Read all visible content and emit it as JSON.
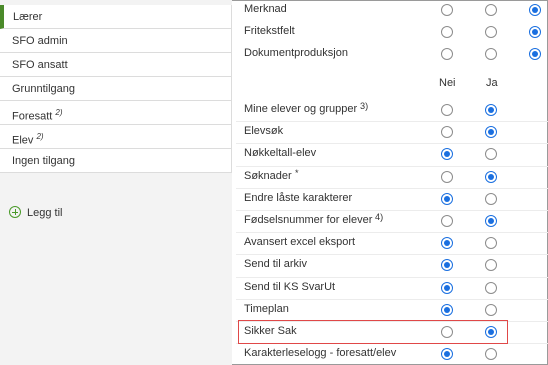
{
  "sidebar": {
    "items": [
      {
        "label": "Lærer",
        "sup": "",
        "active": true
      },
      {
        "label": "SFO admin",
        "sup": "",
        "active": false
      },
      {
        "label": "SFO ansatt",
        "sup": "",
        "active": false
      },
      {
        "label": "Grunntilgang",
        "sup": "",
        "active": false
      },
      {
        "label": "Foresatt",
        "sup": "2)",
        "active": false
      },
      {
        "label": "Elev",
        "sup": "2)",
        "active": false
      },
      {
        "label": "Ingen tilgang",
        "sup": "",
        "active": false
      }
    ],
    "add_label": "Legg til"
  },
  "top_rows": [
    {
      "label": "Merknad",
      "selected": 3
    },
    {
      "label": "Fritekstfelt",
      "selected": 3
    },
    {
      "label": "Dokumentproduksjon",
      "selected": 3
    }
  ],
  "headers": {
    "no": "Nei",
    "yes": "Ja"
  },
  "rows": [
    {
      "label": "Mine elever og grupper",
      "sup": "3)",
      "value": "Ja"
    },
    {
      "label": "Elevsøk",
      "sup": "",
      "value": "Ja"
    },
    {
      "label": "Nøkkeltall-elev",
      "sup": "",
      "value": "Nei"
    },
    {
      "label": "Søknader",
      "sup": "*",
      "value": "Ja"
    },
    {
      "label": "Endre låste karakterer",
      "sup": "",
      "value": "Nei"
    },
    {
      "label": "Fødselsnummer for elever",
      "sup": "4)",
      "value": "Ja"
    },
    {
      "label": "Avansert excel eksport",
      "sup": "",
      "value": "Nei"
    },
    {
      "label": "Send til arkiv",
      "sup": "",
      "value": "Nei"
    },
    {
      "label": "Send til KS SvarUt",
      "sup": "",
      "value": "Nei"
    },
    {
      "label": "Timeplan",
      "sup": "",
      "value": "Nei"
    },
    {
      "label": "Sikker Sak",
      "sup": "",
      "value": "Ja"
    },
    {
      "label": "Karakterleselogg - foresatt/elev",
      "sup": "",
      "value": "Nei"
    }
  ],
  "colors": {
    "accent": "#1a6fe0",
    "active_marker": "#4a8a2a",
    "highlight": "#e04848"
  }
}
